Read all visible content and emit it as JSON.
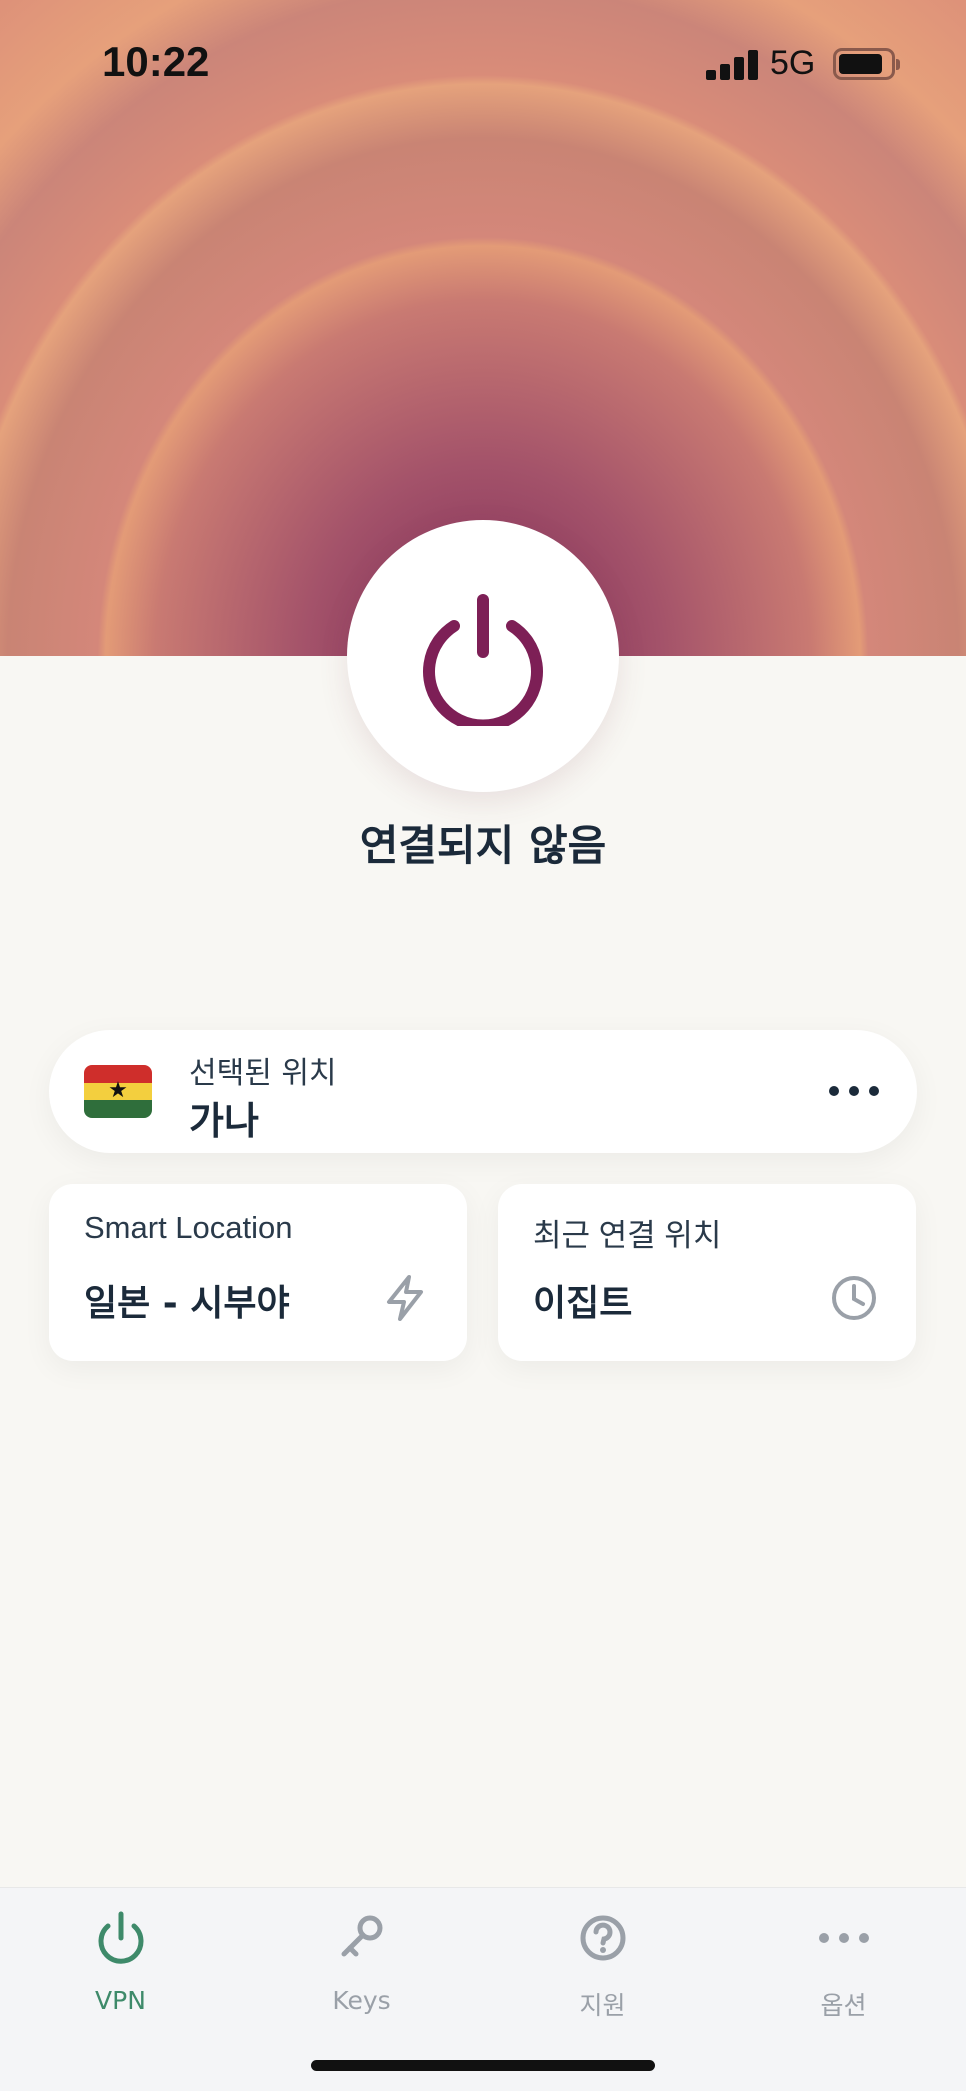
{
  "status_bar": {
    "time": "10:22",
    "network": "5G"
  },
  "hero": {
    "power_button_icon": "power-icon",
    "connection_status": "연결되지 않음"
  },
  "selected_location": {
    "label": "선택된 위치",
    "value": "가나",
    "flag_icon": "ghana-flag-icon",
    "more_icon": "more-icon"
  },
  "smart_location": {
    "label": "Smart Location",
    "value": "일본 - 시부야",
    "icon": "lightning-icon"
  },
  "recent_location": {
    "label": "최근 연결 위치",
    "value": "이집트",
    "icon": "clock-icon"
  },
  "tabs": [
    {
      "label": "VPN",
      "icon": "power-icon",
      "active": true
    },
    {
      "label": "Keys",
      "icon": "key-icon",
      "active": false
    },
    {
      "label": "지원",
      "icon": "help-icon",
      "active": false
    },
    {
      "label": "옵션",
      "icon": "more-icon",
      "active": false
    }
  ],
  "colors": {
    "accent": "#7d1f56",
    "active_tab": "#3e8a6a",
    "inactive_tab": "#9aa0a8",
    "background": "#f8f7f3"
  }
}
